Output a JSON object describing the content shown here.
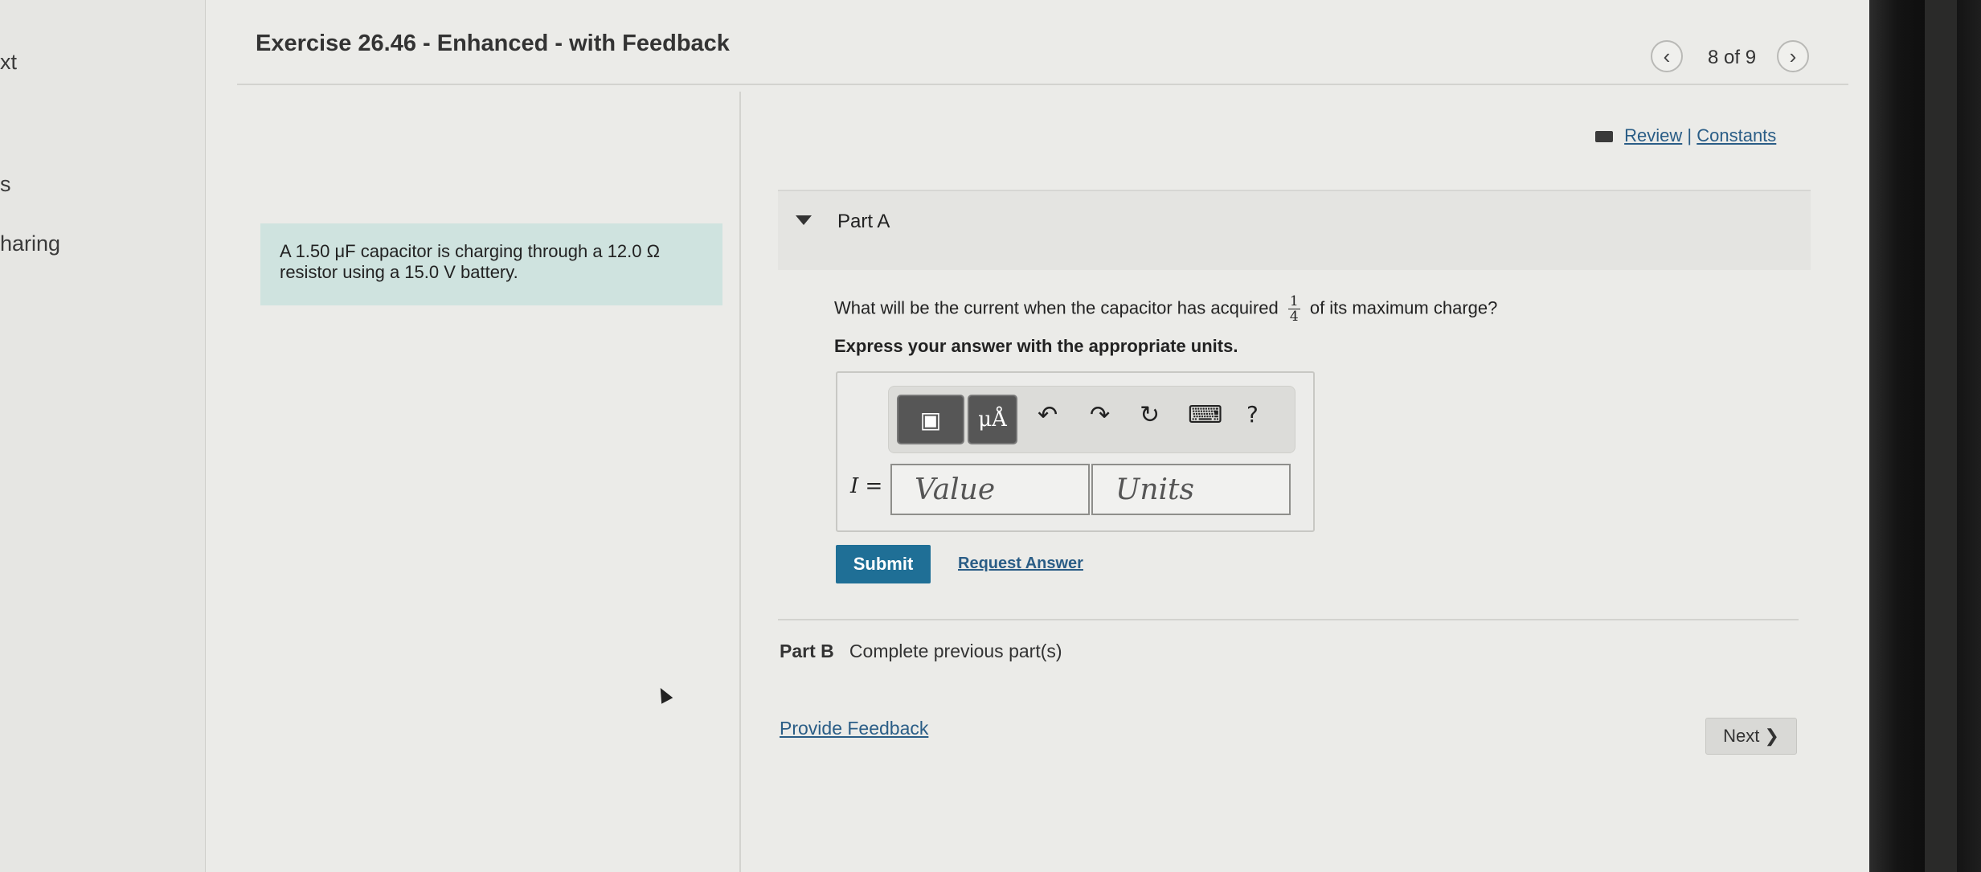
{
  "sidebar": {
    "fragments": [
      "xt",
      "s",
      "haring"
    ]
  },
  "header": {
    "title": "Exercise 26.46 - Enhanced - with Feedback",
    "prev_icon": "‹",
    "next_icon": "›",
    "page_count": "8 of 9"
  },
  "context": {
    "text": "A 1.50 μF capacitor is charging through a 12.0 Ω resistor using a 15.0 V battery."
  },
  "review": {
    "review_label": "Review",
    "separator": "|",
    "constants_label": "Constants"
  },
  "partA": {
    "label": "Part A",
    "question_before": "What will be the current when the capacitor has acquired",
    "fraction_num": "1",
    "fraction_den": "4",
    "question_after": "of its maximum charge?",
    "express": "Express your answer with the appropriate units.",
    "toolbar": {
      "templates_icon": "▣",
      "units_label": "μÅ",
      "undo_icon": "↶",
      "redo_icon": "↷",
      "reset_icon": "↻",
      "keyboard_icon": "⌨",
      "help_label": "?"
    },
    "variable_label": "I =",
    "value_placeholder": "Value",
    "units_placeholder": "Units",
    "submit_label": "Submit",
    "request_label": "Request Answer"
  },
  "partB": {
    "label": "Part B",
    "status": "Complete previous part(s)"
  },
  "footer": {
    "feedback_label": "Provide Feedback",
    "next_label": "Next ❯"
  },
  "colors": {
    "accent": "#1f6f96",
    "link": "#2a5d86",
    "context_bg": "#cfe3df"
  }
}
